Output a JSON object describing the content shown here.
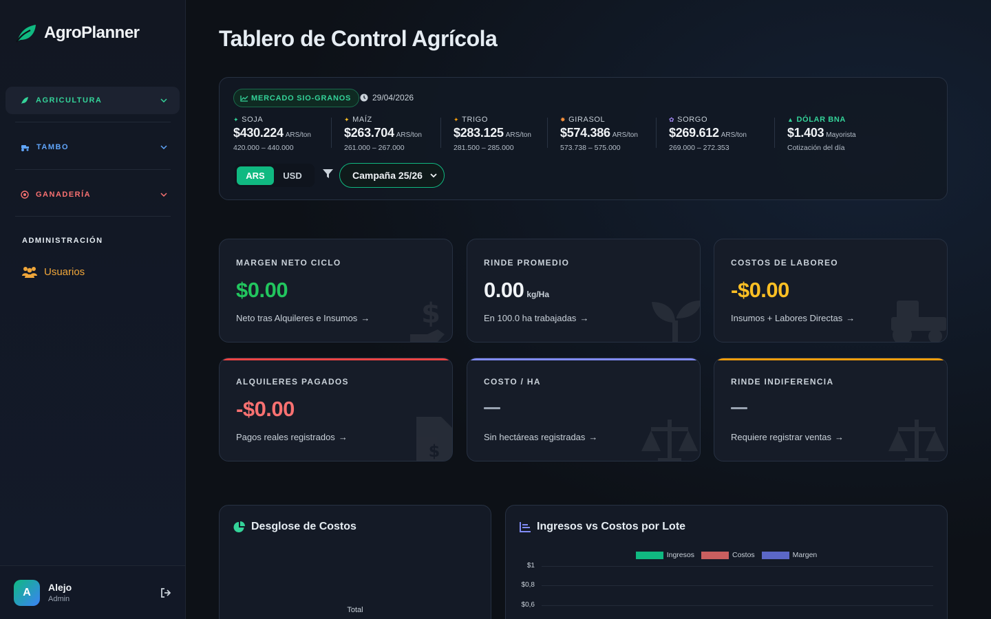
{
  "app": {
    "name": "AgroPlanner"
  },
  "sidebar": {
    "groups": [
      {
        "label": "AGRICULTURA",
        "color": "#34d399",
        "icon": "leaf-icon"
      },
      {
        "label": "TAMBO",
        "color": "#60a5fa",
        "icon": "tractor-icon"
      },
      {
        "label": "GANADERÍA",
        "color": "#f87171",
        "icon": "target-icon"
      }
    ],
    "admin_title": "ADMINISTRACIÓN",
    "admin_link": "Usuarios",
    "user": {
      "initial": "A",
      "name": "Alejo",
      "role": "Admin"
    }
  },
  "page": {
    "title": "Tablero de Control Agrícola"
  },
  "market": {
    "badge": "MERCADO SIO-GRANOS",
    "date": "29/04/2026",
    "quotes": [
      {
        "name": "SOJA",
        "price": "$430.224",
        "unit": "ARS/ton",
        "range": "420.000 – 440.000",
        "color": "#34d399"
      },
      {
        "name": "MAÍZ",
        "price": "$263.704",
        "unit": "ARS/ton",
        "range": "261.000 – 267.000",
        "color": "#fbbf24"
      },
      {
        "name": "TRIGO",
        "price": "$283.125",
        "unit": "ARS/ton",
        "range": "281.500 – 285.000",
        "color": "#f59e0b"
      },
      {
        "name": "GIRASOL",
        "price": "$574.386",
        "unit": "ARS/ton",
        "range": "573.738 – 575.000",
        "color": "#fb923c"
      },
      {
        "name": "SORGO",
        "price": "$269.612",
        "unit": "ARS/ton",
        "range": "269.000 – 272.353",
        "color": "#a78bfa"
      },
      {
        "name": "DÓLAR BNA",
        "price": "$1.403",
        "unit": "Mayorista",
        "range": "Cotización del día",
        "color": "#34d399"
      }
    ],
    "currency": {
      "ars": "ARS",
      "usd": "USD",
      "selected": "ARS"
    },
    "campaign": "Campaña 25/26"
  },
  "kpis": [
    {
      "label": "MARGEN NETO CICLO",
      "value": "$0.00",
      "unit": "",
      "sub": "Neto tras Alquileres e Insumos",
      "color": "#22c55e",
      "accent": ""
    },
    {
      "label": "RINDE PROMEDIO",
      "value": "0.00",
      "unit": "kg/Ha",
      "sub": "En 100.0 ha trabajadas",
      "color": "#f0f3f6",
      "accent": ""
    },
    {
      "label": "COSTOS DE LABOREO",
      "value": "-$0.00",
      "unit": "",
      "sub": "Insumos + Labores Directas",
      "color": "#fbbf24",
      "accent": ""
    },
    {
      "label": "ALQUILERES PAGADOS",
      "value": "-$0.00",
      "unit": "",
      "sub": "Pagos reales registrados",
      "color": "#f87171",
      "accent": "#ef4444"
    },
    {
      "label": "COSTO / HA",
      "value": "",
      "unit": "",
      "sub": "Sin hectáreas registradas",
      "color": "#f0f3f6",
      "accent": "#818cf8"
    },
    {
      "label": "RINDE INDIFERENCIA",
      "value": "",
      "unit": "",
      "sub": "Requiere registrar ventas",
      "color": "#f0f3f6",
      "accent": "#f59e0b"
    }
  ],
  "panels": {
    "costs": {
      "title": "Desglose de Costos",
      "total_label": "Total"
    },
    "income": {
      "title": "Ingresos vs Costos por Lote"
    }
  },
  "chart_data": {
    "type": "bar",
    "series": [
      {
        "name": "Ingresos",
        "values": [],
        "color": "#10b981"
      },
      {
        "name": "Costos",
        "values": [],
        "color": "#c95f5f"
      },
      {
        "name": "Margen",
        "values": [],
        "color": "#5b67c7"
      }
    ],
    "categories": [],
    "y_ticks": [
      "$1",
      "$0,8",
      "$0,6"
    ],
    "ylim": [
      0,
      1
    ],
    "grid": true,
    "legend": "top-center"
  }
}
